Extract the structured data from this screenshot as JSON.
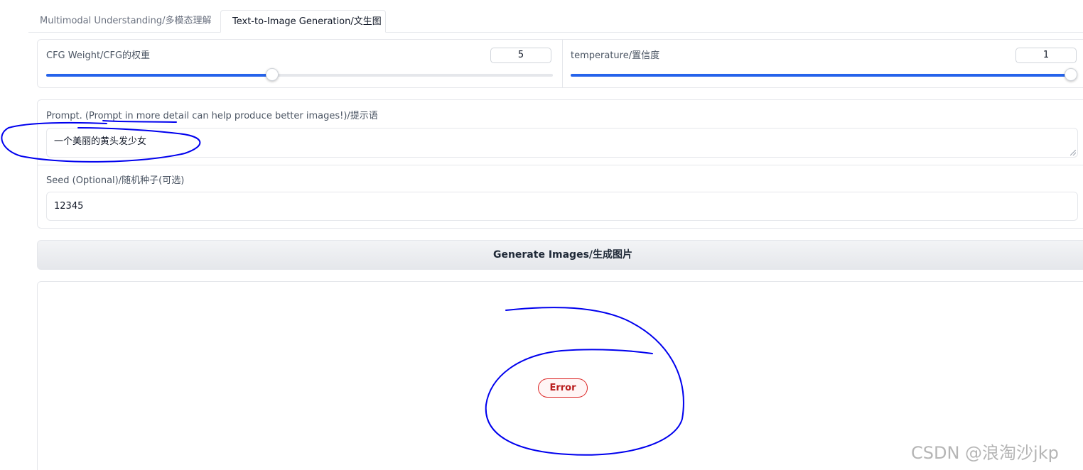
{
  "tabs": [
    {
      "label": "Multimodal Understanding/多模态理解",
      "active": false
    },
    {
      "label": "Text-to-Image Generation/文生图",
      "active": true
    }
  ],
  "cfg": {
    "label": "CFG Weight/CFG的权重",
    "value": "5",
    "fraction": 0.446
  },
  "temperature": {
    "label": "temperature/置信度",
    "value": "1",
    "fraction": 1.0
  },
  "prompt": {
    "label": "Prompt. (Prompt in more detail can help produce better images!)/提示语",
    "value": "一个美丽的黄头发少女"
  },
  "seed": {
    "label": "Seed (Optional)/随机种子(可选)",
    "value": "12345"
  },
  "generate_button": {
    "label": "Generate Images/生成图片"
  },
  "output": {
    "status": "Error"
  },
  "watermark": "CSDN @浪淘沙jkp",
  "colors": {
    "accent": "#2563eb",
    "error": "#dc2626",
    "annotation": "#0000ee"
  }
}
